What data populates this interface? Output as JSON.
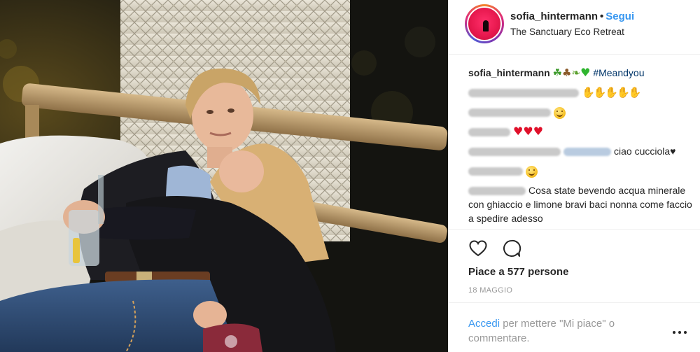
{
  "photo": {
    "description_icon": "photo-image"
  },
  "header": {
    "username": "sofia_hintermann",
    "separator": "•",
    "follow_label": "Segui",
    "location": "The Sanctuary Eco Retreat"
  },
  "caption": {
    "username": "sofia_hintermann",
    "hashtag": "#Meandyou"
  },
  "comments": [
    {
      "text": ""
    },
    {
      "text": ""
    },
    {
      "text": ""
    },
    {
      "text": "ciao cucciola♥"
    },
    {
      "text": ""
    },
    {
      "text": "Cosa state bevendo acqua minerale con ghiaccio e limone bravi baci nonna come faccio a spedire adesso"
    }
  ],
  "likes": {
    "text": "Piace a 577 persone"
  },
  "date": "18 MAGGIO",
  "login_prompt": {
    "link": "Accedi",
    "rest": " per mettere \"Mi piace\" o commentare."
  },
  "colors": {
    "accent": "#3897f0",
    "text": "#262626",
    "muted": "#999999",
    "link": "#003569"
  }
}
